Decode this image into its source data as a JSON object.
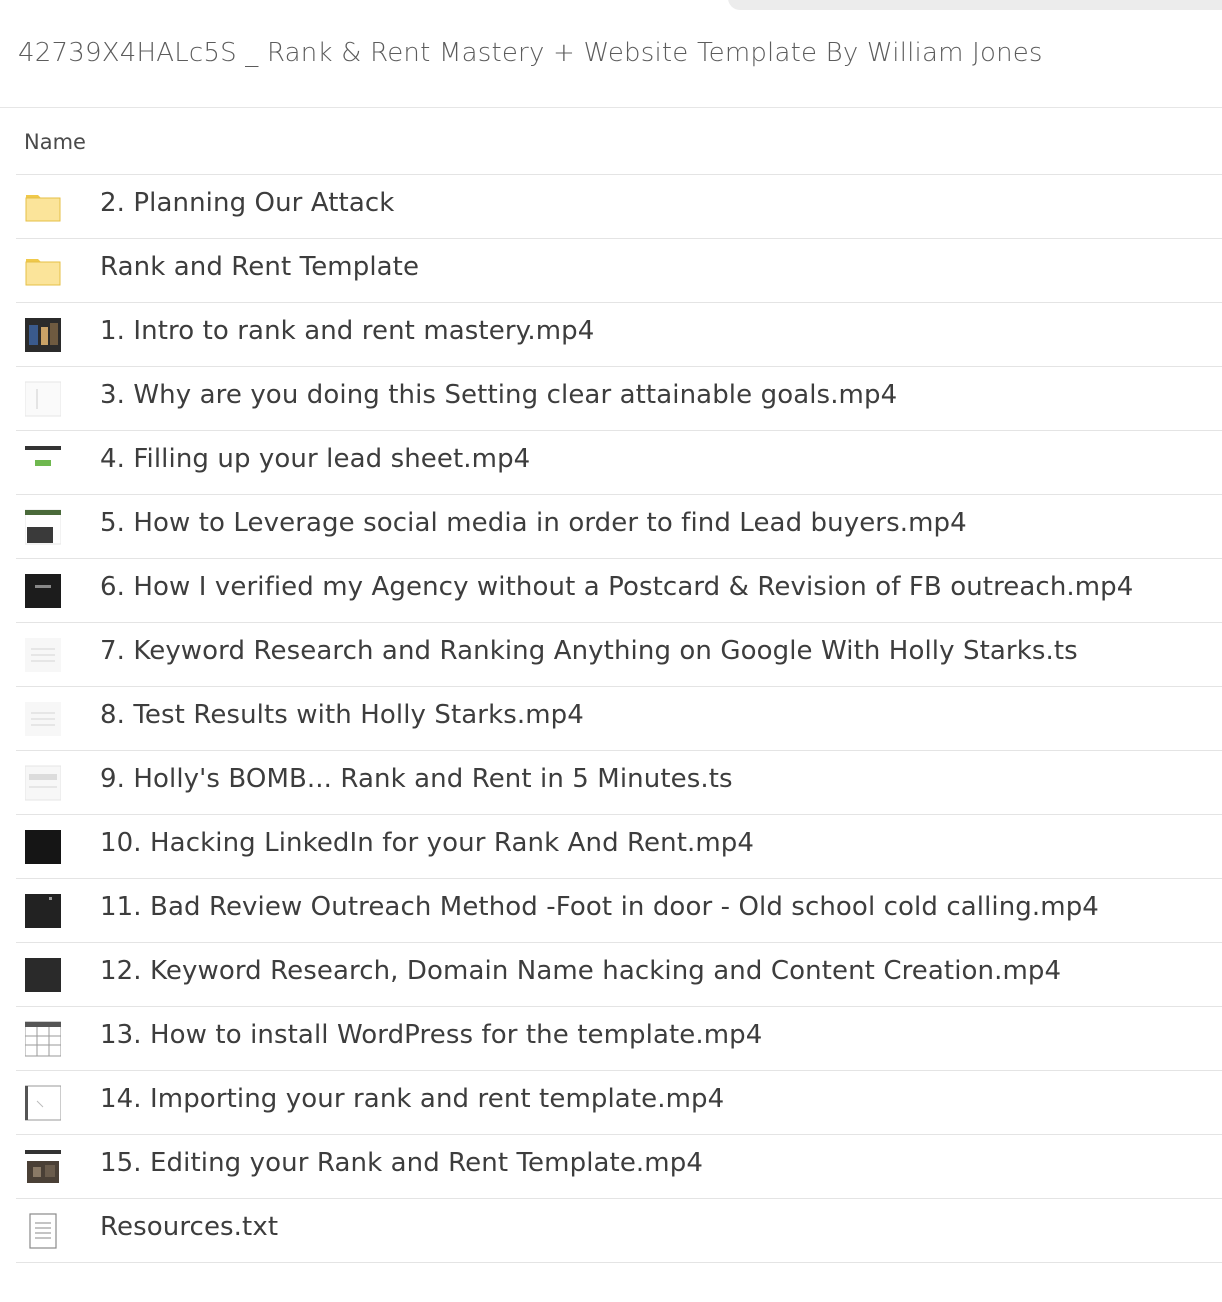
{
  "folder": {
    "title": "42739X4HALc5S _ Rank & Rent Mastery + Website Template By William Jones"
  },
  "table": {
    "column_name": "Name"
  },
  "files": [
    {
      "name": "2. Planning Our Attack",
      "icon": "folder-icon"
    },
    {
      "name": "Rank and Rent Template",
      "icon": "folder-icon"
    },
    {
      "name": "1. Intro to rank and rent mastery.mp4",
      "icon": "video-thumbnail-icon"
    },
    {
      "name": "3. Why are you doing this Setting clear attainable goals.mp4",
      "icon": "video-thumbnail-icon"
    },
    {
      "name": "4. Filling up your lead sheet.mp4",
      "icon": "video-thumbnail-icon"
    },
    {
      "name": "5. How to Leverage social media in order to find Lead buyers.mp4",
      "icon": "video-thumbnail-icon"
    },
    {
      "name": "6. How I verified my Agency without a Postcard & Revision of FB outreach.mp4",
      "icon": "video-thumbnail-icon"
    },
    {
      "name": "7. Keyword Research and Ranking Anything on Google With Holly Starks.ts",
      "icon": "video-thumbnail-icon"
    },
    {
      "name": "8. Test Results with Holly Starks.mp4",
      "icon": "video-thumbnail-icon"
    },
    {
      "name": "9. Holly's BOMB... Rank and Rent in 5 Minutes.ts",
      "icon": "video-thumbnail-icon"
    },
    {
      "name": "10. Hacking LinkedIn for your Rank And Rent.mp4",
      "icon": "video-thumbnail-icon"
    },
    {
      "name": "11. Bad Review Outreach Method -Foot in door - Old school cold calling.mp4",
      "icon": "video-thumbnail-icon"
    },
    {
      "name": "12. Keyword Research, Domain Name hacking and Content Creation.mp4",
      "icon": "video-thumbnail-icon"
    },
    {
      "name": "13. How to install WordPress for the template.mp4",
      "icon": "video-thumbnail-icon"
    },
    {
      "name": "14. Importing your rank and rent template.mp4",
      "icon": "video-thumbnail-icon"
    },
    {
      "name": "15. Editing your Rank and Rent Template.mp4",
      "icon": "video-thumbnail-icon"
    },
    {
      "name": "Resources.txt",
      "icon": "text-file-icon"
    }
  ]
}
